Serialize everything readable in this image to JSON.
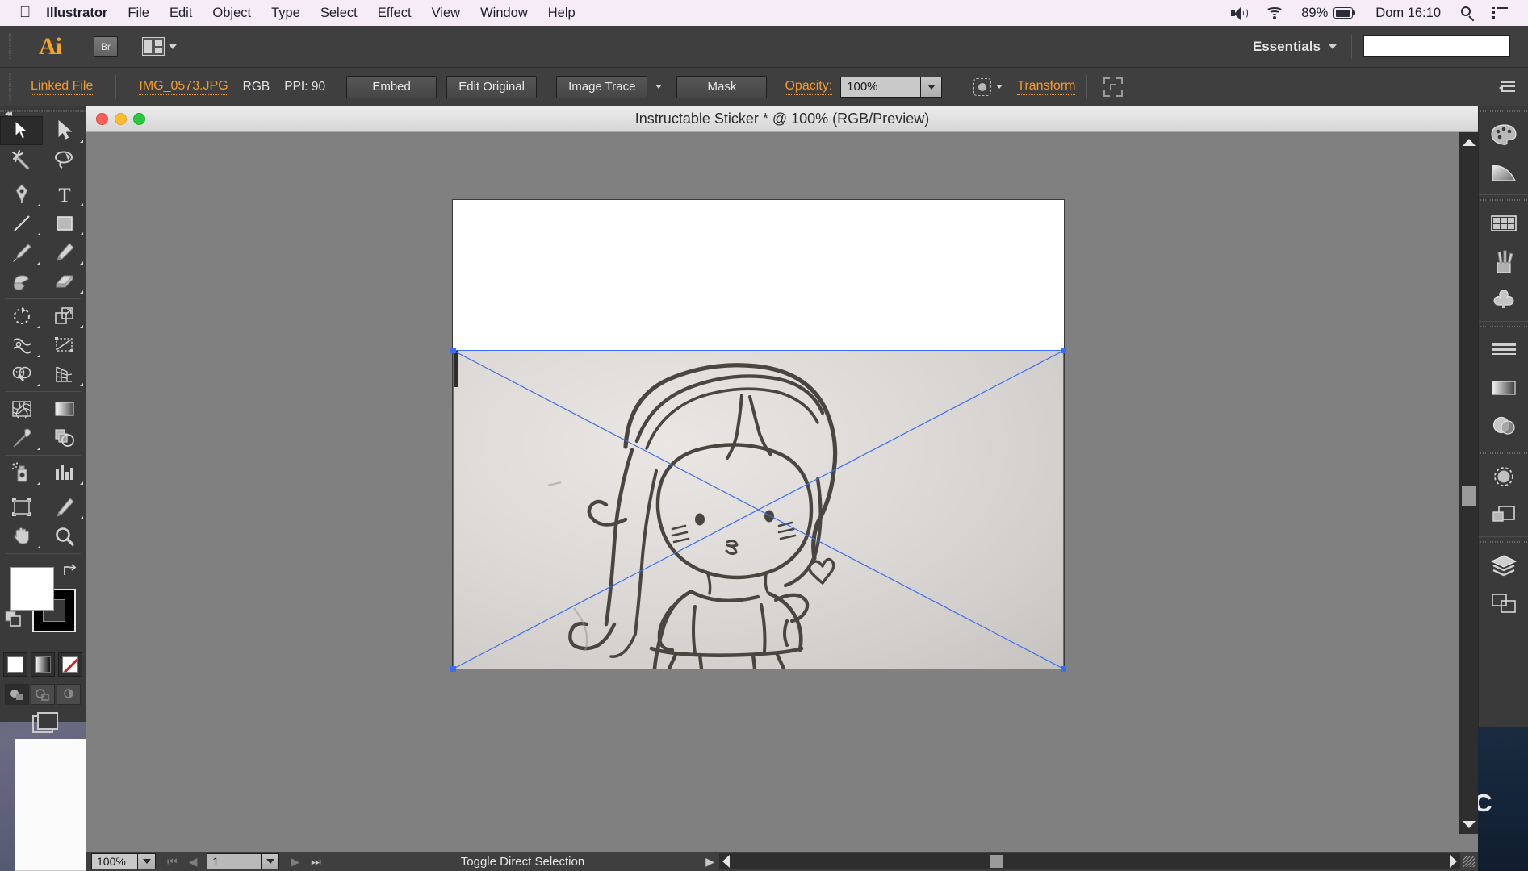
{
  "menubar": {
    "apple_icon": "apple-logo-icon",
    "app_name": "Illustrator",
    "items": [
      "File",
      "Edit",
      "Object",
      "Type",
      "Select",
      "Effect",
      "View",
      "Window",
      "Help"
    ],
    "status": {
      "volume_icon": "volume-icon",
      "wifi_icon": "wifi-icon",
      "battery_percent": "89%",
      "battery_icon": "battery-icon",
      "clock": "Dom 16:10",
      "search_icon": "spotlight-search-icon",
      "notification_icon": "notification-center-icon"
    }
  },
  "appbar": {
    "logo": "Ai",
    "bridge_label": "Br",
    "arrange_icon": "arrange-documents-icon",
    "workspace": "Essentials",
    "workspace_caret": "chevron-down-icon",
    "search_value": "",
    "search_placeholder": ""
  },
  "controlbar": {
    "object_type": "Linked File",
    "file_name": "IMG_0573.JPG",
    "color_mode": "RGB",
    "ppi": "PPI: 90",
    "embed_label": "Embed",
    "edit_original_label": "Edit Original",
    "image_trace_label": "Image Trace",
    "image_trace_caret": "chevron-down-icon",
    "mask_label": "Mask",
    "opacity_label": "Opacity:",
    "opacity_value": "100%",
    "opacity_caret": "chevron-down-icon",
    "isolate_icon": "isolate-selection-icon",
    "transform_label": "Transform",
    "crop_icon": "crop-image-icon",
    "panel_menu_icon": "panel-menu-icon"
  },
  "toolbar": {
    "collapse_icon": "collapse-panel-icon",
    "tools": [
      {
        "name": "selection-tool",
        "selected": true,
        "has_flyout": false
      },
      {
        "name": "direct-selection-tool",
        "selected": false,
        "has_flyout": true
      },
      {
        "name": "magic-wand-tool",
        "selected": false,
        "has_flyout": false
      },
      {
        "name": "lasso-tool",
        "selected": false,
        "has_flyout": false
      },
      {
        "name": "pen-tool",
        "selected": false,
        "has_flyout": true
      },
      {
        "name": "type-tool",
        "selected": false,
        "has_flyout": true
      },
      {
        "name": "line-segment-tool",
        "selected": false,
        "has_flyout": true
      },
      {
        "name": "rectangle-tool",
        "selected": false,
        "has_flyout": true
      },
      {
        "name": "paintbrush-tool",
        "selected": false,
        "has_flyout": true
      },
      {
        "name": "pencil-tool",
        "selected": false,
        "has_flyout": true
      },
      {
        "name": "blob-brush-tool",
        "selected": false,
        "has_flyout": false
      },
      {
        "name": "eraser-tool",
        "selected": false,
        "has_flyout": true
      },
      {
        "name": "rotate-tool",
        "selected": false,
        "has_flyout": true
      },
      {
        "name": "scale-tool",
        "selected": false,
        "has_flyout": true
      },
      {
        "name": "width-tool",
        "selected": false,
        "has_flyout": true
      },
      {
        "name": "free-transform-tool",
        "selected": false,
        "has_flyout": false
      },
      {
        "name": "shape-builder-tool",
        "selected": false,
        "has_flyout": true
      },
      {
        "name": "perspective-grid-tool",
        "selected": false,
        "has_flyout": true
      },
      {
        "name": "mesh-tool",
        "selected": false,
        "has_flyout": false
      },
      {
        "name": "gradient-tool",
        "selected": false,
        "has_flyout": false
      },
      {
        "name": "eyedropper-tool",
        "selected": false,
        "has_flyout": true
      },
      {
        "name": "blend-tool",
        "selected": false,
        "has_flyout": false
      },
      {
        "name": "symbol-sprayer-tool",
        "selected": false,
        "has_flyout": true
      },
      {
        "name": "column-graph-tool",
        "selected": false,
        "has_flyout": true
      },
      {
        "name": "artboard-tool",
        "selected": false,
        "has_flyout": false
      },
      {
        "name": "slice-tool",
        "selected": false,
        "has_flyout": true
      },
      {
        "name": "hand-tool",
        "selected": false,
        "has_flyout": true
      },
      {
        "name": "zoom-tool",
        "selected": false,
        "has_flyout": false
      }
    ],
    "fill_color": "#ffffff",
    "stroke_color": "#000000",
    "swap_icon": "swap-fill-stroke-icon",
    "default_icon": "default-fill-stroke-icon",
    "color_modes": [
      "color-fill-mode",
      "gradient-fill-mode",
      "none-fill-mode"
    ],
    "screen_modes": [
      "normal-screen-mode",
      "full-screen-menubar-mode",
      "full-screen-mode"
    ],
    "drawing_mode_icon": "drawing-modes-icon"
  },
  "document": {
    "title": "Instructable Sticker   * @ 100% (RGB/Preview)",
    "close_button": "close-window-button",
    "minimize_button": "minimize-window-button",
    "zoom_button": "zoom-window-button",
    "artwork_description": "Pencil sketch of a chibi girl with long wavy hair, headband, blushing cheeks, holding a heart, wearing a dress"
  },
  "statusbar": {
    "zoom_value": "100%",
    "zoom_caret": "chevron-down-icon",
    "first_page_icon": "first-artboard-icon",
    "prev_page_icon": "previous-artboard-icon",
    "page_value": "1",
    "page_caret": "chevron-down-icon",
    "next_page_icon": "next-artboard-icon",
    "last_page_icon": "last-artboard-icon",
    "status_text": "Toggle Direct Selection",
    "status_caret": "status-menu-icon",
    "hscroll_left_icon": "scroll-left-icon",
    "hscroll_right_icon": "scroll-right-icon",
    "resize_grip": "window-resize-grip"
  },
  "rightdock": {
    "collapse_icon": "collapse-dock-icon",
    "groups": [
      {
        "icons": [
          "color-panel-icon",
          "color-guide-panel-icon"
        ]
      },
      {
        "icons": [
          "swatches-panel-icon",
          "brushes-panel-icon",
          "symbols-panel-icon"
        ]
      },
      {
        "icons": [
          "stroke-panel-icon",
          "gradient-panel-icon",
          "transparency-panel-icon"
        ]
      },
      {
        "icons": [
          "appearance-panel-icon",
          "graphic-styles-panel-icon"
        ]
      },
      {
        "icons": [
          "layers-panel-icon",
          "artboards-panel-icon"
        ]
      }
    ]
  },
  "desktop": {
    "wallpaper": "yosemite-mountain-wallpaper",
    "visible_text": "OC"
  },
  "colors": {
    "menubar_bg": "#f5ecf7",
    "app_chrome": "#3f3f3f",
    "panel_bg": "#3a3a3a",
    "accent_orange": "#f49b2e",
    "selection_blue": "#3a6df0",
    "canvas_gray": "#808080"
  }
}
